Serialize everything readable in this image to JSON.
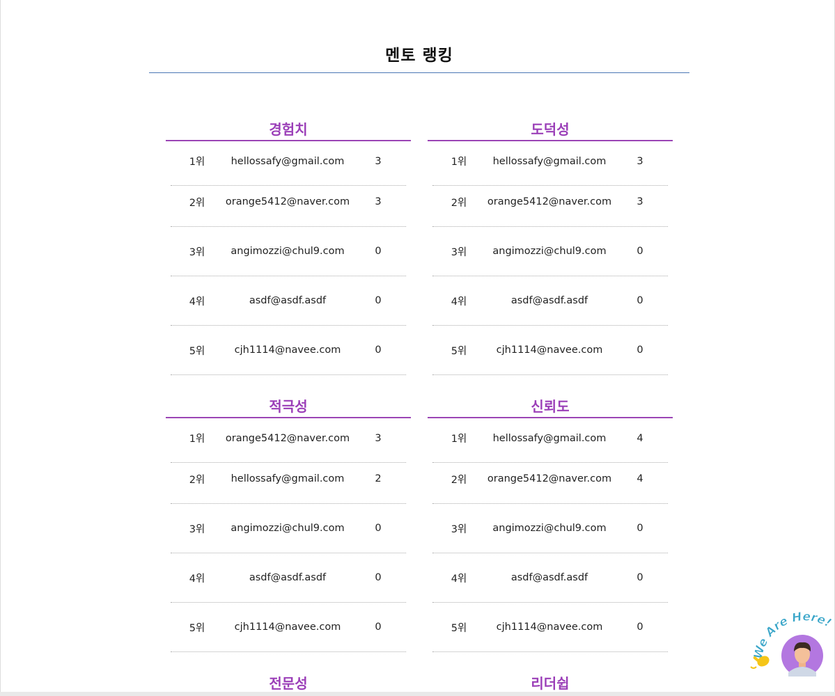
{
  "page_title": "멘토 랭킹",
  "panels": [
    {
      "title": "경험치",
      "rows": [
        {
          "rank": "1위",
          "email": "hellossafy@gmail.com",
          "score": "3"
        },
        {
          "rank": "2위",
          "email": "orange5412@naver.com",
          "score": "3"
        },
        {
          "rank": "3위",
          "email": "angimozzi@chul9.com",
          "score": "0"
        },
        {
          "rank": "4위",
          "email": "asdf@asdf.asdf",
          "score": "0"
        },
        {
          "rank": "5위",
          "email": "cjh1114@navee.com",
          "score": "0"
        }
      ]
    },
    {
      "title": "도덕성",
      "rows": [
        {
          "rank": "1위",
          "email": "hellossafy@gmail.com",
          "score": "3"
        },
        {
          "rank": "2위",
          "email": "orange5412@naver.com",
          "score": "3"
        },
        {
          "rank": "3위",
          "email": "angimozzi@chul9.com",
          "score": "0"
        },
        {
          "rank": "4위",
          "email": "asdf@asdf.asdf",
          "score": "0"
        },
        {
          "rank": "5위",
          "email": "cjh1114@navee.com",
          "score": "0"
        }
      ]
    },
    {
      "title": "적극성",
      "rows": [
        {
          "rank": "1위",
          "email": "orange5412@naver.com",
          "score": "3"
        },
        {
          "rank": "2위",
          "email": "hellossafy@gmail.com",
          "score": "2"
        },
        {
          "rank": "3위",
          "email": "angimozzi@chul9.com",
          "score": "0"
        },
        {
          "rank": "4위",
          "email": "asdf@asdf.asdf",
          "score": "0"
        },
        {
          "rank": "5위",
          "email": "cjh1114@navee.com",
          "score": "0"
        }
      ]
    },
    {
      "title": "신뢰도",
      "rows": [
        {
          "rank": "1위",
          "email": "hellossafy@gmail.com",
          "score": "4"
        },
        {
          "rank": "2위",
          "email": "orange5412@naver.com",
          "score": "4"
        },
        {
          "rank": "3위",
          "email": "angimozzi@chul9.com",
          "score": "0"
        },
        {
          "rank": "4위",
          "email": "asdf@asdf.asdf",
          "score": "0"
        },
        {
          "rank": "5위",
          "email": "cjh1114@navee.com",
          "score": "0"
        }
      ]
    },
    {
      "title": "전문성",
      "rows": []
    },
    {
      "title": "리더쉽",
      "rows": []
    }
  ],
  "mascot": {
    "text": "We Are Here!",
    "icon": "person-avatar-icon",
    "hand_icon": "waving-hand-icon"
  },
  "colors": {
    "accent_purple": "#9b3fb8",
    "title_underline": "#4a77b4"
  }
}
